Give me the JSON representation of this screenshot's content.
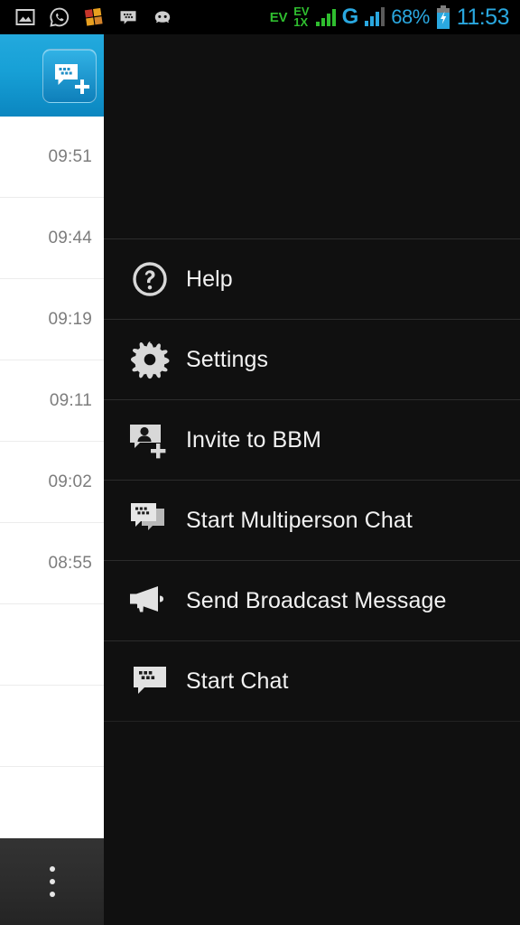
{
  "status_bar": {
    "left_icons": [
      {
        "name": "gallery-icon"
      },
      {
        "name": "whatsapp-icon"
      },
      {
        "name": "microsoft-squares-icon"
      },
      {
        "name": "bbm-icon"
      },
      {
        "name": "robot-face-icon"
      }
    ],
    "network_label": "EV",
    "network_sub_top": "EV",
    "network_sub_bottom": "1X",
    "carrier_letter": "G",
    "battery_percent": "68%",
    "battery_icon": "battery-charging-icon",
    "clock": "11:53",
    "accent_color": "#2aa8e0",
    "signal_color": "#2fbe2f"
  },
  "sidebar": {
    "header": {
      "icon": "bbm-add-chat-icon",
      "background_color": "#17a0d6"
    },
    "chat_times": [
      "09:51",
      "09:44",
      "09:19",
      "09:11",
      "09:02",
      "08:55"
    ],
    "bottom_bar": {
      "overflow_icon": "overflow-menu-icon"
    }
  },
  "menu": {
    "background_color": "#101010",
    "items": [
      {
        "label": "Help",
        "icon": "help-circle-icon"
      },
      {
        "label": "Settings",
        "icon": "gear-icon"
      },
      {
        "label": "Invite to BBM",
        "icon": "person-add-icon"
      },
      {
        "label": "Start Multiperson Chat",
        "icon": "multi-chat-icon"
      },
      {
        "label": "Send Broadcast Message",
        "icon": "megaphone-icon"
      },
      {
        "label": "Start Chat",
        "icon": "chat-bubble-icon"
      }
    ]
  }
}
